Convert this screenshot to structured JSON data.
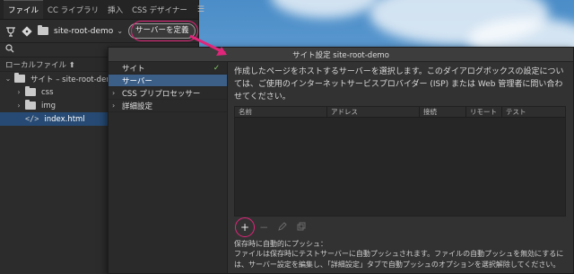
{
  "files_panel": {
    "tabs": [
      "ファイル",
      "CC ライブラリ",
      "挿入",
      "CSS デザイナー"
    ],
    "site_name": "site-root-demo",
    "define_server_label": "サーバーを定義",
    "local_files_label": "ローカルファイル ⬆",
    "tree": [
      {
        "label": "サイト – site-root-demo",
        "type": "site"
      },
      {
        "label": "css",
        "type": "folder"
      },
      {
        "label": "img",
        "type": "folder"
      },
      {
        "label": "index.html",
        "type": "file"
      }
    ]
  },
  "dialog": {
    "title": "サイト設定 site-root-demo",
    "nav": [
      {
        "label": "サイト",
        "checked": true
      },
      {
        "label": "サーバー",
        "selected": true
      },
      {
        "label": "CSS プリプロセッサー"
      },
      {
        "label": "詳細設定"
      }
    ],
    "description": "作成したページをホストするサーバーを選択します。このダイアログボックスの設定については、ご使用のインターネットサービスプロバイダー (ISP) または Web 管理者に問い合わせてください。",
    "table_headers": [
      "名前",
      "アドレス",
      "接続",
      "リモート",
      "テスト"
    ],
    "auto_push_title": "保存時に自動的にプッシュ：",
    "auto_push_text": "ファイルは保存時にテストサーバーに自動プッシュされます。ファイルの自動プッシュを無効にするには、サーバー設定を編集し、「詳細設定」タブで自動プッシュのオプションを選択解除してください。"
  },
  "colors": {
    "highlight": "#e0267a",
    "selection": "#264a73"
  }
}
